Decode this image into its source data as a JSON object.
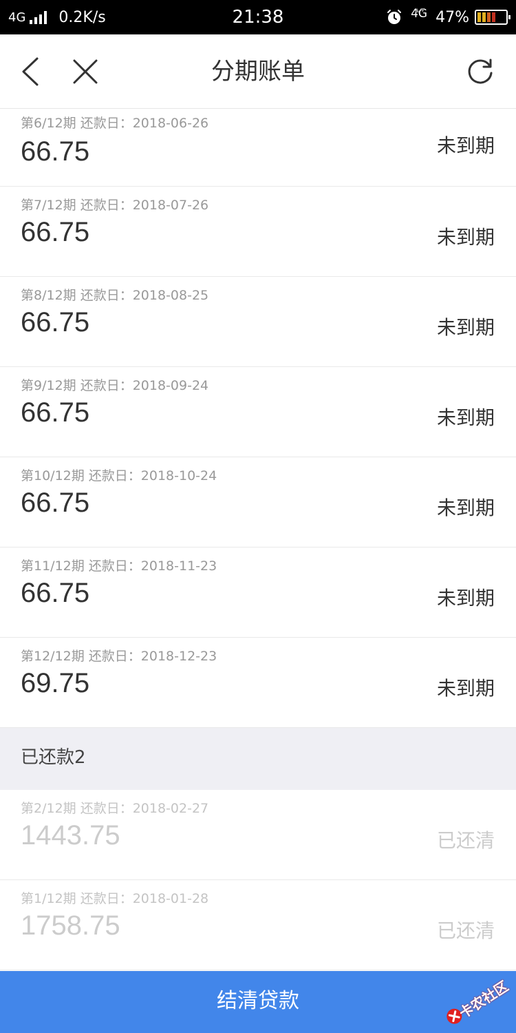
{
  "status_bar": {
    "network_left": "4G",
    "speed": "0.2K/s",
    "time": "21:38",
    "network_right": "4G",
    "battery": "47%",
    "icons": [
      "signal-bars-icon",
      "alarm-icon",
      "battery-icon"
    ]
  },
  "nav": {
    "title": "分期账单",
    "icons": {
      "back": "chevron-left-icon",
      "close": "close-icon",
      "refresh": "refresh-icon"
    }
  },
  "bills_pending": [
    {
      "meta": "第6/12期 还款日：2018-06-26",
      "amount": "66.75",
      "status": "未到期"
    },
    {
      "meta": "第7/12期 还款日：2018-07-26",
      "amount": "66.75",
      "status": "未到期"
    },
    {
      "meta": "第8/12期 还款日：2018-08-25",
      "amount": "66.75",
      "status": "未到期"
    },
    {
      "meta": "第9/12期 还款日：2018-09-24",
      "amount": "66.75",
      "status": "未到期"
    },
    {
      "meta": "第10/12期 还款日：2018-10-24",
      "amount": "66.75",
      "status": "未到期"
    },
    {
      "meta": "第11/12期 还款日：2018-11-23",
      "amount": "66.75",
      "status": "未到期"
    },
    {
      "meta": "第12/12期 还款日：2018-12-23",
      "amount": "69.75",
      "status": "未到期"
    }
  ],
  "paid_section": {
    "title": "已还款2"
  },
  "bills_paid": [
    {
      "meta": "第2/12期 还款日：2018-02-27",
      "amount": "1443.75",
      "status": "已还清"
    },
    {
      "meta": "第1/12期 还款日：2018-01-28",
      "amount": "1758.75",
      "status": "已还清"
    }
  ],
  "footer": {
    "settle_label": "结清贷款"
  },
  "watermark": {
    "text": "卡农社区"
  },
  "colors": {
    "accent": "#4286ea",
    "section_bg": "#efeff4",
    "watermark": "#e02020"
  }
}
